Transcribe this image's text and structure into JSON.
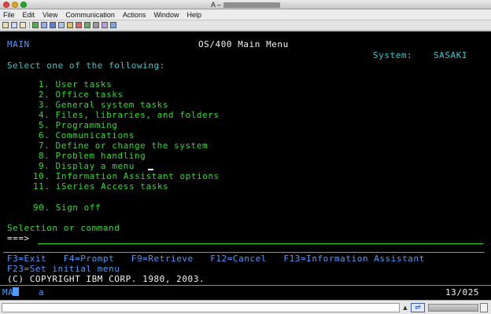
{
  "window": {
    "title": "A –"
  },
  "menubar": [
    "File",
    "Edit",
    "View",
    "Communication",
    "Actions",
    "Window",
    "Help"
  ],
  "screen": {
    "screen_id": "MAIN",
    "screen_title": "OS/400 Main Menu",
    "system_label": "System:",
    "system_name": "SASAKI",
    "prompt": "Select one of the following:",
    "options": [
      {
        "num": "1.",
        "label": "User tasks"
      },
      {
        "num": "2.",
        "label": "Office tasks"
      },
      {
        "num": "3.",
        "label": "General system tasks"
      },
      {
        "num": "4.",
        "label": "Files, libraries, and folders"
      },
      {
        "num": "5.",
        "label": "Programming"
      },
      {
        "num": "6.",
        "label": "Communications"
      },
      {
        "num": "7.",
        "label": "Define or change the system"
      },
      {
        "num": "8.",
        "label": "Problem handling"
      },
      {
        "num": "9.",
        "label": "Display a menu"
      },
      {
        "num": "10.",
        "label": "Information Assistant options"
      },
      {
        "num": "11.",
        "label": "iSeries Access tasks"
      },
      {
        "num": "90.",
        "label": "Sign off"
      }
    ],
    "selection_label": "Selection or command",
    "command_arrow": "===>",
    "fkeys_line1": "F3=Exit   F4=Prompt   F9=Retrieve   F12=Cancel   F13=Information Assistant",
    "fkeys_line2": "F23=Set initial menu",
    "copyright": "(C) COPYRIGHT IBM CORP. 1980, 2003.",
    "oia_left": "MA",
    "oia_mode": "a",
    "cursor_position": "13/025"
  },
  "colors": {
    "screen_bg": "#000000",
    "green": "#2fdc2f",
    "turquoise": "#38c9c9",
    "blue": "#4d9cff",
    "white": "#f4f4f4"
  }
}
